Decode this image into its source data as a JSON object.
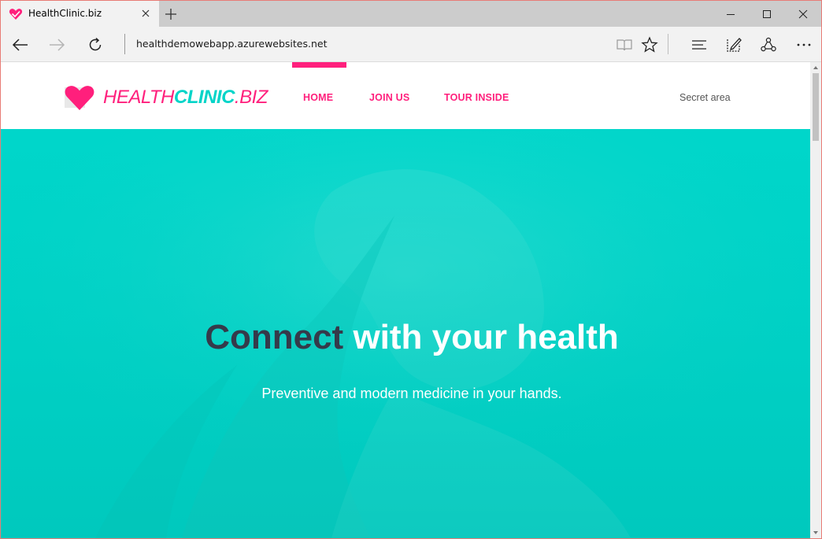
{
  "browser": {
    "tab": {
      "title": "HealthClinic.biz",
      "favicon": "heart-icon"
    },
    "url": "healthdemowebapp.azurewebsites.net",
    "toolbar_icons": [
      "reading-view-icon",
      "favorite-star-icon",
      "hub-icon",
      "web-note-icon",
      "share-icon",
      "more-icon"
    ]
  },
  "site": {
    "logo": {
      "part1": "HEALTH",
      "part2": "CLINIC",
      "part3": ".BIZ"
    },
    "nav": [
      {
        "label": "HOME"
      },
      {
        "label": "JOIN US"
      },
      {
        "label": "TOUR INSIDE"
      }
    ],
    "secret_area": "Secret area",
    "hero": {
      "title_dark": "Connect",
      "title_light": "with your health",
      "subtitle": "Preventive and modern medicine in your hands."
    }
  },
  "colors": {
    "brand_pink": "#ff1f7c",
    "brand_teal": "#00d6ca",
    "title_dark": "#353a4a"
  }
}
